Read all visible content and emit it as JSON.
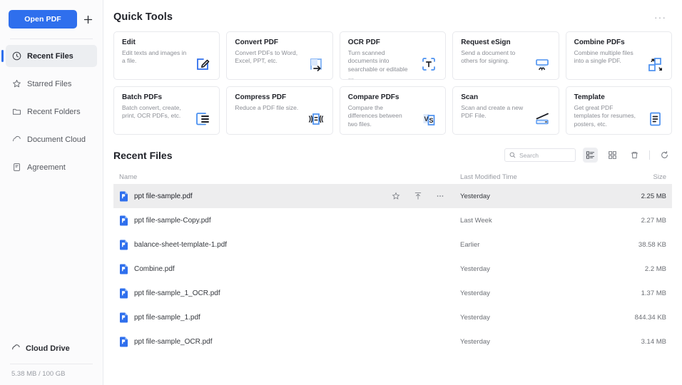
{
  "sidebar": {
    "open_pdf_label": "Open PDF",
    "add_icon": "plus-icon",
    "items": [
      {
        "label": "Recent Files",
        "icon": "clock-icon",
        "active": true
      },
      {
        "label": "Starred Files",
        "icon": "star-icon",
        "active": false
      },
      {
        "label": "Recent Folders",
        "icon": "folder-icon",
        "active": false
      },
      {
        "label": "Document Cloud",
        "icon": "cloud-icon",
        "active": false
      },
      {
        "label": "Agreement",
        "icon": "document-icon",
        "active": false
      }
    ],
    "cloud_drive_label": "Cloud Drive",
    "cloud_drive_icon": "cloud-icon",
    "storage_text": "5.38 MB / 100 GB"
  },
  "quick_tools": {
    "title": "Quick Tools",
    "more_menu": "···",
    "cards": [
      {
        "name": "Edit",
        "desc": "Edit texts and images in a file.",
        "icon": "edit-pencil-icon"
      },
      {
        "name": "Convert PDF",
        "desc": "Convert PDFs to Word, Excel, PPT, etc.",
        "icon": "convert-arrow-icon"
      },
      {
        "name": "OCR PDF",
        "desc": "Turn scanned documents into searchable or editable …",
        "icon": "ocr-text-icon"
      },
      {
        "name": "Request eSign",
        "desc": "Send a document to others for signing.",
        "icon": "esign-signature-icon"
      },
      {
        "name": "Combine PDFs",
        "desc": "Combine multiple files into a single PDF.",
        "icon": "combine-squares-icon"
      },
      {
        "name": "Batch PDFs",
        "desc": "Batch convert, create, print, OCR PDFs, etc.",
        "icon": "batch-pages-icon"
      },
      {
        "name": "Compress PDF",
        "desc": "Reduce a PDF file size.",
        "icon": "compress-icon"
      },
      {
        "name": "Compare PDFs",
        "desc": "Compare the differences between two files.",
        "icon": "compare-vs-icon"
      },
      {
        "name": "Scan",
        "desc": "Scan and create a new PDF File.",
        "icon": "scanner-icon"
      },
      {
        "name": "Template",
        "desc": "Get great PDF templates for resumes, posters, etc.",
        "icon": "template-icon"
      }
    ]
  },
  "recent_files": {
    "title": "Recent Files",
    "search": {
      "placeholder": "Search",
      "value": "",
      "icon": "search-icon"
    },
    "view_buttons": [
      {
        "name": "list-view",
        "icon": "list-view-icon",
        "active": true
      },
      {
        "name": "grid-view",
        "icon": "grid-view-icon",
        "active": false
      },
      {
        "name": "trash",
        "icon": "trash-icon",
        "active": false
      }
    ],
    "refresh_icon": "refresh-icon",
    "columns": {
      "name": "Name",
      "date": "Last Modified Time",
      "size": "Size"
    },
    "row_actions": [
      {
        "name": "star-icon"
      },
      {
        "name": "upload-icon"
      },
      {
        "name": "more-icon"
      }
    ],
    "rows": [
      {
        "name": "ppt file-sample.pdf",
        "date": "Yesterday",
        "size": "2.25 MB",
        "selected": true
      },
      {
        "name": "ppt file-sample-Copy.pdf",
        "date": "Last Week",
        "size": "2.27 MB",
        "selected": false
      },
      {
        "name": "balance-sheet-template-1.pdf",
        "date": "Earlier",
        "size": "38.58 KB",
        "selected": false
      },
      {
        "name": "Combine.pdf",
        "date": "Yesterday",
        "size": "2.2 MB",
        "selected": false
      },
      {
        "name": "ppt file-sample_1_OCR.pdf",
        "date": "Yesterday",
        "size": "1.37 MB",
        "selected": false
      },
      {
        "name": "ppt file-sample_1.pdf",
        "date": "Yesterday",
        "size": "844.34 KB",
        "selected": false
      },
      {
        "name": "ppt file-sample_OCR.pdf",
        "date": "Yesterday",
        "size": "3.14 MB",
        "selected": false
      }
    ]
  },
  "colors": {
    "accent": "#2f6fed",
    "pdf_icon": "#2f6fed",
    "selected_row": "#ededee",
    "text_primary": "#1f2128",
    "text_muted": "#8b8e95"
  }
}
